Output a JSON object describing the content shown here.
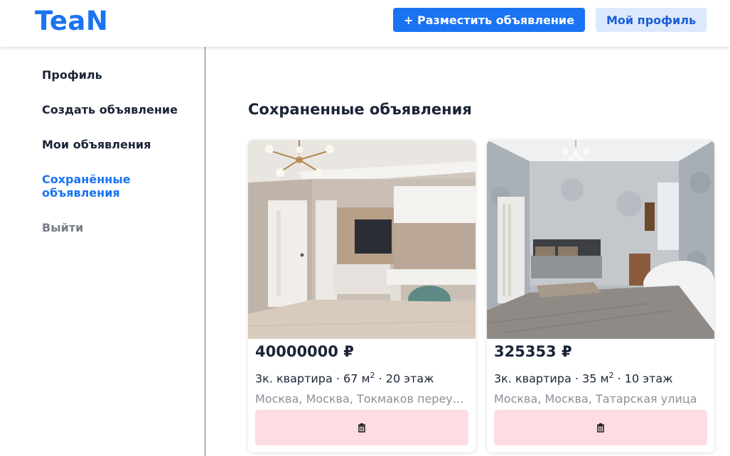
{
  "header": {
    "logo": "TeaN",
    "post_button": "+ Разместить объявление",
    "profile_button": "Мой профиль"
  },
  "sidebar": {
    "items": [
      {
        "label": "Профиль"
      },
      {
        "label": "Создать объявление"
      },
      {
        "label": "Мои объявления"
      },
      {
        "label": "Сохранённые объявления"
      },
      {
        "label": "Выйти"
      }
    ]
  },
  "main": {
    "title": "Сохраненные объявления",
    "listings": [
      {
        "price": "40000000 ₽",
        "rooms": "3к. квартира",
        "area": "67 м",
        "area_unit_power": "2",
        "floor": "20 этаж",
        "address": "Москва, Москва, Токмаков переулок",
        "remove_icon": "trash-icon"
      },
      {
        "price": "325353 ₽",
        "rooms": "3к. квартира",
        "area": "35 м",
        "area_unit_power": "2",
        "floor": "10 этаж",
        "address": "Москва, Москва, Татарская улица",
        "remove_icon": "trash-icon"
      }
    ]
  },
  "colors": {
    "accent": "#1a73f2",
    "accent_light": "#dce9fd",
    "danger_light": "#fddde2",
    "text": "#1b2437",
    "muted": "#8a8f98"
  }
}
